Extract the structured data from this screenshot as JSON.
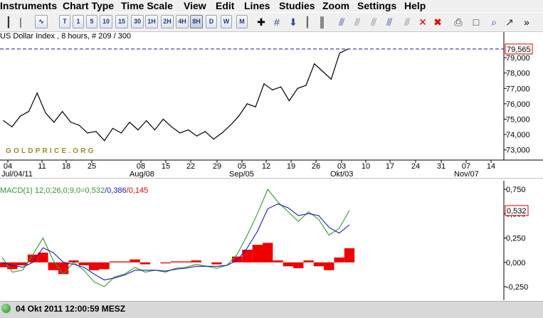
{
  "menu": {
    "items": [
      "Instruments",
      "Chart Type",
      "Time Scale",
      "View",
      "Edit",
      "Lines",
      "Studies",
      "Zoom",
      "Settings",
      "Help"
    ]
  },
  "toolbar": {
    "bar_chart_icon": "ohlc-bars-icon",
    "line_chart_icon": "line-chart-icon",
    "timeframes": [
      "T",
      "1",
      "5",
      "10",
      "15",
      "30",
      "1H",
      "2H",
      "4H",
      "8H",
      "D",
      "W",
      "M"
    ],
    "active_timeframe": "8H",
    "tools": [
      "crosshair-icon",
      "grid-icon",
      "arrow-down-icon",
      "bars-icon",
      "studies-icon",
      "indicator-a-icon",
      "indicator-b-icon",
      "indicator-c-icon",
      "indicator-d-icon",
      "remove-indicator-icon",
      "close-x-icon",
      "delete-all-icon",
      "print-icon",
      "window-icon",
      "zoom-icon",
      "pin-icon",
      "more-icon"
    ]
  },
  "main_chart": {
    "header": "US Dollar Index , 8 hours, # 209 / 300",
    "watermark": "GOLDPRICE.ORG",
    "last_price_label": "79,565",
    "line_color": "#000000",
    "ref_line_color": "#1a1a8c",
    "y_tick_labels": [
      "79,000",
      "78,000",
      "77,000",
      "76,000",
      "75,000",
      "74,000",
      "73,000"
    ],
    "x_tick_labels": [
      "04",
      "11",
      "18",
      "25",
      "08",
      "15",
      "22",
      "29",
      "05",
      "12",
      "19",
      "26",
      "03",
      "10",
      "17",
      "24",
      "31",
      "07",
      "14"
    ],
    "x_month_labels": [
      "Jul/04/11",
      "Aug/08",
      "Sep/05",
      "Okt/03",
      "Nov/07"
    ]
  },
  "chart_data": [
    {
      "type": "line",
      "title": "US Dollar Index , 8 hours, # 209 / 300",
      "ylim": [
        73000,
        80000
      ],
      "x": [
        "Jul/04",
        "Jul/06",
        "Jul/08",
        "Jul/11",
        "Jul/12",
        "Jul/13",
        "Jul/15",
        "Jul/18",
        "Jul/20",
        "Jul/22",
        "Jul/25",
        "Jul/27",
        "Jul/29",
        "Aug/01",
        "Aug/03",
        "Aug/05",
        "Aug/08",
        "Aug/10",
        "Aug/12",
        "Aug/15",
        "Aug/17",
        "Aug/19",
        "Aug/22",
        "Aug/24",
        "Aug/26",
        "Aug/29",
        "Aug/31",
        "Sep/02",
        "Sep/05",
        "Sep/07",
        "Sep/09",
        "Sep/12",
        "Sep/14",
        "Sep/16",
        "Sep/19",
        "Sep/21",
        "Sep/23",
        "Sep/26",
        "Sep/28",
        "Sep/30",
        "Okt/03",
        "Okt/04"
      ],
      "values": [
        74900,
        74500,
        75200,
        75500,
        76700,
        75400,
        74800,
        75500,
        74800,
        74600,
        74100,
        74200,
        73600,
        74400,
        74100,
        74800,
        74300,
        74900,
        74300,
        75000,
        74500,
        74100,
        74300,
        73900,
        74200,
        73700,
        74100,
        74600,
        75200,
        76000,
        75800,
        77300,
        76900,
        77100,
        76200,
        77000,
        77200,
        78600,
        78100,
        77600,
        79300,
        79565
      ],
      "reference_line": 79565
    },
    {
      "type": "line",
      "title": "MACD(1) 12,0;26,0;9,0=0,532/0,386/0,145",
      "ylim": [
        -0.3,
        0.8
      ],
      "x_tick_labels_shared": true,
      "series": [
        {
          "name": "0,532",
          "color": "#2e9a2e",
          "values": [
            0.05,
            -0.1,
            -0.08,
            0.08,
            0.25,
            0.02,
            -0.12,
            0.0,
            -0.08,
            -0.2,
            -0.25,
            -0.15,
            -0.12,
            -0.05,
            -0.1,
            -0.08,
            -0.1,
            -0.06,
            -0.05,
            -0.02,
            -0.04,
            -0.06,
            -0.03,
            0.08,
            0.28,
            0.5,
            0.75,
            0.62,
            0.52,
            0.42,
            0.52,
            0.44,
            0.28,
            0.35,
            0.532
          ]
        },
        {
          "name": "0,386",
          "color": "#1a1ab4",
          "values": [
            0.0,
            -0.03,
            -0.05,
            0.0,
            0.15,
            0.1,
            0.0,
            -0.02,
            -0.05,
            -0.12,
            -0.18,
            -0.16,
            -0.13,
            -0.08,
            -0.08,
            -0.08,
            -0.09,
            -0.07,
            -0.06,
            -0.04,
            -0.04,
            -0.04,
            -0.03,
            0.02,
            0.15,
            0.32,
            0.55,
            0.6,
            0.56,
            0.48,
            0.5,
            0.48,
            0.36,
            0.3,
            0.386
          ]
        },
        {
          "name": "0,145",
          "color": "#ee0000",
          "values": [
            -0.05,
            -0.07,
            -0.03,
            0.08,
            0.1,
            -0.08,
            -0.12,
            0.02,
            -0.03,
            -0.08,
            -0.07,
            0.01,
            0.01,
            0.03,
            -0.02,
            0.0,
            -0.01,
            0.01,
            0.01,
            0.02,
            0.0,
            -0.02,
            0.0,
            0.06,
            0.13,
            0.18,
            0.2,
            0.02,
            -0.04,
            -0.06,
            0.02,
            -0.04,
            -0.08,
            0.05,
            0.145
          ]
        }
      ]
    }
  ],
  "macd_panel": {
    "header_prefix": "MACD(1) 12,0;26,0;9,0=",
    "header_macd": "0,532",
    "header_signal": "/0,386",
    "header_hist": "/0,145",
    "last_value_label": "0,532",
    "y_tick_labels": [
      "0,750",
      "0,500",
      "0,250",
      "0,000",
      "-0,250"
    ]
  },
  "status": {
    "datetime": "04 Okt 2011 12:00:59 MESZ"
  }
}
